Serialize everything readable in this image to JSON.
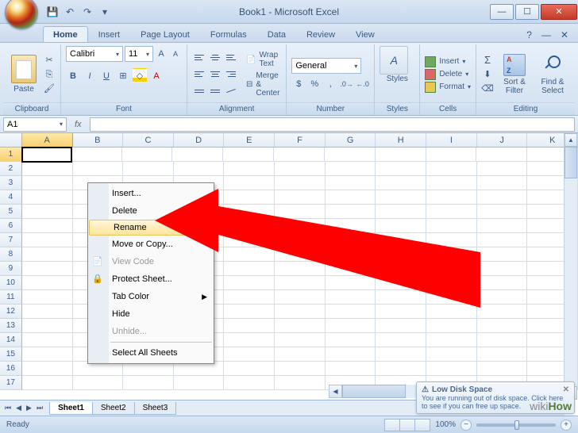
{
  "window": {
    "title": "Book1 - Microsoft Excel"
  },
  "qat": {
    "save": "💾",
    "undo": "↶",
    "redo": "↷"
  },
  "tabs": [
    "Home",
    "Insert",
    "Page Layout",
    "Formulas",
    "Data",
    "Review",
    "View"
  ],
  "ribbon": {
    "clipboard": {
      "label": "Clipboard",
      "paste": "Paste"
    },
    "font": {
      "label": "Font",
      "name": "Calibri",
      "size": "11"
    },
    "alignment": {
      "label": "Alignment",
      "wrap": "Wrap Text",
      "merge": "Merge & Center"
    },
    "number": {
      "label": "Number",
      "format": "General"
    },
    "styles": {
      "label": "Styles",
      "btn": "Styles"
    },
    "cells": {
      "label": "Cells",
      "insert": "Insert",
      "delete": "Delete",
      "format": "Format"
    },
    "editing": {
      "label": "Editing",
      "sort": "Sort & Filter",
      "find": "Find & Select"
    }
  },
  "formula_bar": {
    "name_box": "A1",
    "fx": "fx"
  },
  "columns": [
    "A",
    "B",
    "C",
    "D",
    "E",
    "F",
    "G",
    "H",
    "I",
    "J",
    "K"
  ],
  "rows_visible": 17,
  "active_cell": "A1",
  "context_menu": {
    "items": [
      {
        "label": "Insert...",
        "icon": ""
      },
      {
        "label": "Delete",
        "icon": ""
      },
      {
        "label": "Rename",
        "icon": "",
        "highlight": true
      },
      {
        "label": "Move or Copy...",
        "icon": ""
      },
      {
        "label": "View Code",
        "icon": "📄",
        "disabled": true
      },
      {
        "label": "Protect Sheet...",
        "icon": "🔒"
      },
      {
        "label": "Tab Color",
        "icon": "",
        "submenu": true
      },
      {
        "label": "Hide",
        "icon": ""
      },
      {
        "label": "Unhide...",
        "icon": "",
        "disabled": true
      },
      {
        "label": "Select All Sheets",
        "icon": ""
      }
    ]
  },
  "sheets": [
    "Sheet1",
    "Sheet2",
    "Sheet3"
  ],
  "status": {
    "ready": "Ready",
    "zoom": "100%"
  },
  "notification": {
    "title": "Low Disk Space",
    "body": "You are running out of disk space. Click here to see if you can free up space."
  },
  "watermark": "wikiHow"
}
